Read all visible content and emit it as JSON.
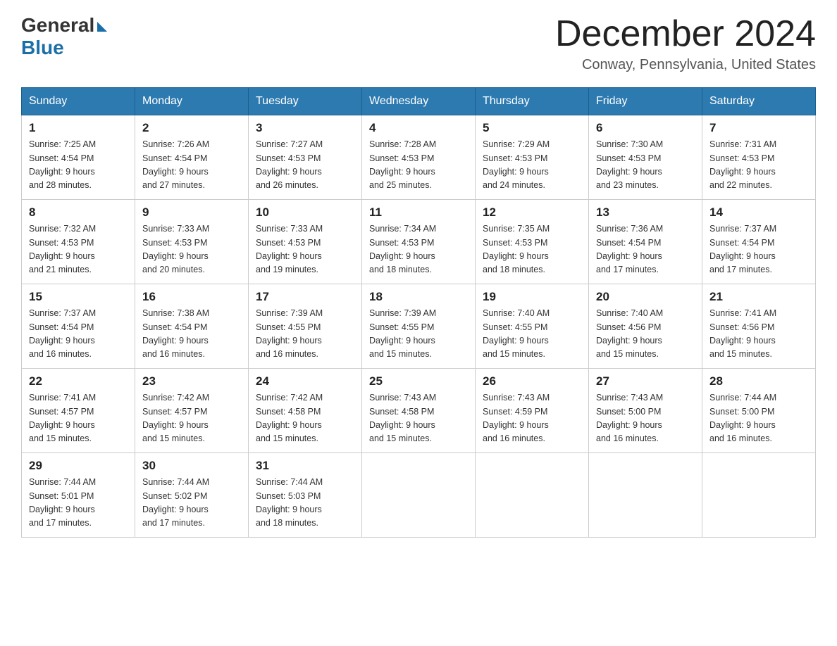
{
  "header": {
    "logo": {
      "general_text": "General",
      "blue_text": "Blue"
    },
    "title": "December 2024",
    "location": "Conway, Pennsylvania, United States"
  },
  "days_of_week": [
    "Sunday",
    "Monday",
    "Tuesday",
    "Wednesday",
    "Thursday",
    "Friday",
    "Saturday"
  ],
  "weeks": [
    [
      {
        "day": "1",
        "sunrise": "7:25 AM",
        "sunset": "4:54 PM",
        "daylight": "9 hours and 28 minutes."
      },
      {
        "day": "2",
        "sunrise": "7:26 AM",
        "sunset": "4:54 PM",
        "daylight": "9 hours and 27 minutes."
      },
      {
        "day": "3",
        "sunrise": "7:27 AM",
        "sunset": "4:53 PM",
        "daylight": "9 hours and 26 minutes."
      },
      {
        "day": "4",
        "sunrise": "7:28 AM",
        "sunset": "4:53 PM",
        "daylight": "9 hours and 25 minutes."
      },
      {
        "day": "5",
        "sunrise": "7:29 AM",
        "sunset": "4:53 PM",
        "daylight": "9 hours and 24 minutes."
      },
      {
        "day": "6",
        "sunrise": "7:30 AM",
        "sunset": "4:53 PM",
        "daylight": "9 hours and 23 minutes."
      },
      {
        "day": "7",
        "sunrise": "7:31 AM",
        "sunset": "4:53 PM",
        "daylight": "9 hours and 22 minutes."
      }
    ],
    [
      {
        "day": "8",
        "sunrise": "7:32 AM",
        "sunset": "4:53 PM",
        "daylight": "9 hours and 21 minutes."
      },
      {
        "day": "9",
        "sunrise": "7:33 AM",
        "sunset": "4:53 PM",
        "daylight": "9 hours and 20 minutes."
      },
      {
        "day": "10",
        "sunrise": "7:33 AM",
        "sunset": "4:53 PM",
        "daylight": "9 hours and 19 minutes."
      },
      {
        "day": "11",
        "sunrise": "7:34 AM",
        "sunset": "4:53 PM",
        "daylight": "9 hours and 18 minutes."
      },
      {
        "day": "12",
        "sunrise": "7:35 AM",
        "sunset": "4:53 PM",
        "daylight": "9 hours and 18 minutes."
      },
      {
        "day": "13",
        "sunrise": "7:36 AM",
        "sunset": "4:54 PM",
        "daylight": "9 hours and 17 minutes."
      },
      {
        "day": "14",
        "sunrise": "7:37 AM",
        "sunset": "4:54 PM",
        "daylight": "9 hours and 17 minutes."
      }
    ],
    [
      {
        "day": "15",
        "sunrise": "7:37 AM",
        "sunset": "4:54 PM",
        "daylight": "9 hours and 16 minutes."
      },
      {
        "day": "16",
        "sunrise": "7:38 AM",
        "sunset": "4:54 PM",
        "daylight": "9 hours and 16 minutes."
      },
      {
        "day": "17",
        "sunrise": "7:39 AM",
        "sunset": "4:55 PM",
        "daylight": "9 hours and 16 minutes."
      },
      {
        "day": "18",
        "sunrise": "7:39 AM",
        "sunset": "4:55 PM",
        "daylight": "9 hours and 15 minutes."
      },
      {
        "day": "19",
        "sunrise": "7:40 AM",
        "sunset": "4:55 PM",
        "daylight": "9 hours and 15 minutes."
      },
      {
        "day": "20",
        "sunrise": "7:40 AM",
        "sunset": "4:56 PM",
        "daylight": "9 hours and 15 minutes."
      },
      {
        "day": "21",
        "sunrise": "7:41 AM",
        "sunset": "4:56 PM",
        "daylight": "9 hours and 15 minutes."
      }
    ],
    [
      {
        "day": "22",
        "sunrise": "7:41 AM",
        "sunset": "4:57 PM",
        "daylight": "9 hours and 15 minutes."
      },
      {
        "day": "23",
        "sunrise": "7:42 AM",
        "sunset": "4:57 PM",
        "daylight": "9 hours and 15 minutes."
      },
      {
        "day": "24",
        "sunrise": "7:42 AM",
        "sunset": "4:58 PM",
        "daylight": "9 hours and 15 minutes."
      },
      {
        "day": "25",
        "sunrise": "7:43 AM",
        "sunset": "4:58 PM",
        "daylight": "9 hours and 15 minutes."
      },
      {
        "day": "26",
        "sunrise": "7:43 AM",
        "sunset": "4:59 PM",
        "daylight": "9 hours and 16 minutes."
      },
      {
        "day": "27",
        "sunrise": "7:43 AM",
        "sunset": "5:00 PM",
        "daylight": "9 hours and 16 minutes."
      },
      {
        "day": "28",
        "sunrise": "7:44 AM",
        "sunset": "5:00 PM",
        "daylight": "9 hours and 16 minutes."
      }
    ],
    [
      {
        "day": "29",
        "sunrise": "7:44 AM",
        "sunset": "5:01 PM",
        "daylight": "9 hours and 17 minutes."
      },
      {
        "day": "30",
        "sunrise": "7:44 AM",
        "sunset": "5:02 PM",
        "daylight": "9 hours and 17 minutes."
      },
      {
        "day": "31",
        "sunrise": "7:44 AM",
        "sunset": "5:03 PM",
        "daylight": "9 hours and 18 minutes."
      },
      null,
      null,
      null,
      null
    ]
  ]
}
